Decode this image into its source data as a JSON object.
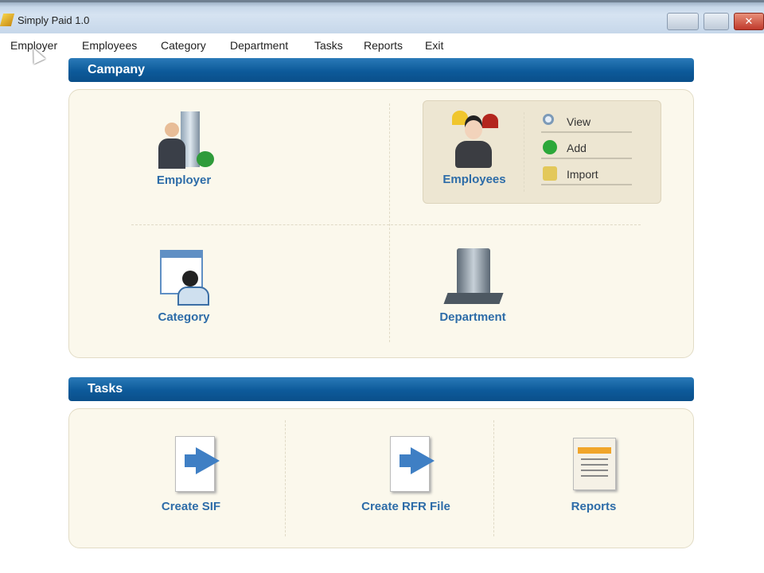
{
  "window": {
    "title": "Simply Paid 1.0",
    "close_glyph": "✕"
  },
  "menu": [
    "Employer",
    "Employees",
    "Category",
    "Department",
    "Tasks",
    "Reports",
    "Exit"
  ],
  "company": {
    "header": "Campany",
    "employer": "Employer",
    "employees": "Employees",
    "category": "Category",
    "department": "Department",
    "employee_actions": [
      "View",
      "Add",
      "Import"
    ]
  },
  "tasks": {
    "header": "Tasks",
    "items": [
      "Create SIF",
      "Create RFR File",
      "Reports"
    ]
  },
  "colors": {
    "header_blue": "#0d5a9a",
    "label_blue": "#2d6ca8",
    "panel_bg": "#fbf8ec"
  }
}
